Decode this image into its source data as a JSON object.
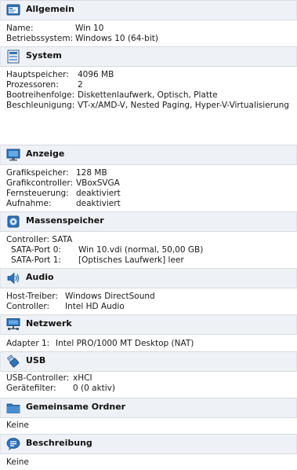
{
  "sections": [
    {
      "title": "Allgemein",
      "icon": "general-settings-icon",
      "rows": [
        {
          "label": "Name:",
          "value": "Win 10"
        },
        {
          "label": "Betriebssystem:",
          "value": "Windows 10 (64-bit)"
        }
      ]
    },
    {
      "title": "System",
      "icon": "system-chip-icon",
      "rows": [
        {
          "label": "Hauptspeicher:",
          "value": "4096 MB"
        },
        {
          "label": "Prozessoren:",
          "value": "2"
        },
        {
          "label": "Bootreihenfolge:",
          "value": "Diskettenlaufwerk, Optisch, Platte"
        },
        {
          "label": "Beschleunigung:",
          "value": "VT-x/AMD-V, Nested Paging, Hyper-V-Virtualisierung"
        }
      ]
    },
    {
      "title": "Anzeige",
      "icon": "display-monitor-icon",
      "rows": [
        {
          "label": "Grafikspeicher:",
          "value": "128 MB"
        },
        {
          "label": "Grafikcontroller:",
          "value": "VBoxSVGA"
        },
        {
          "label": "Fernsteuerung:",
          "value": "deaktiviert"
        },
        {
          "label": "Aufnahme:",
          "value": "deaktiviert"
        }
      ]
    },
    {
      "title": "Massenspeicher",
      "icon": "storage-disk-icon",
      "rows": [
        {
          "label": "Controller: SATA",
          "value": ""
        },
        {
          "label": "SATA-Port 0:",
          "value": "Win 10.vdi (normal, 50,00 GB)"
        },
        {
          "label": "SATA-Port 1:",
          "value": "[Optisches Laufwerk] leer"
        }
      ]
    },
    {
      "title": "Audio",
      "icon": "speaker-icon",
      "rows": [
        {
          "label": "Host-Treiber:",
          "value": "Windows DirectSound"
        },
        {
          "label": "Controller:",
          "value": "Intel HD Audio"
        }
      ]
    },
    {
      "title": "Netzwerk",
      "icon": "network-icon",
      "rows": [
        {
          "label": "Adapter 1:",
          "value": "Intel PRO/1000 MT Desktop (NAT)"
        }
      ]
    },
    {
      "title": "USB",
      "icon": "usb-plug-icon",
      "rows": [
        {
          "label": "USB-Controller:",
          "value": "xHCI"
        },
        {
          "label": "Gerätefilter:",
          "value": "0 (0 aktiv)"
        }
      ]
    },
    {
      "title": "Gemeinsame Ordner",
      "icon": "shared-folder-icon",
      "rows": [
        {
          "label": "Keine",
          "value": ""
        }
      ]
    },
    {
      "title": "Beschreibung",
      "icon": "description-speech-bubble-icon",
      "rows": [
        {
          "label": "Keine",
          "value": ""
        }
      ]
    }
  ]
}
